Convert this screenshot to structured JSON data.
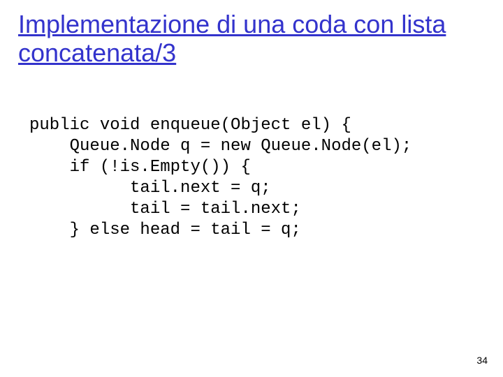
{
  "title": "Implementazione di una coda con lista concatenata/3",
  "code": {
    "l1": "public void enqueue(Object el) {",
    "l2": "    Queue.Node q = new Queue.Node(el);",
    "l3": "    if (!is.Empty()) {",
    "l4": "          tail.next = q;",
    "l5": "          tail = tail.next;",
    "l6": "    } else head = tail = q;"
  },
  "page_number": "34"
}
